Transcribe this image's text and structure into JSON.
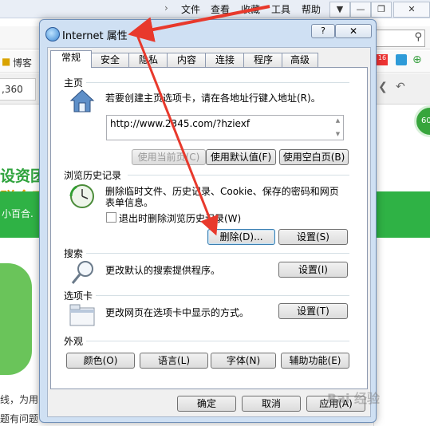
{
  "browser": {
    "menu": [
      "文件",
      "查看",
      "收藏",
      "工具",
      "帮助"
    ],
    "fav_fragment": "博客",
    "tab_fragment": ",360",
    "page_texts": [
      "设资团",
      "赚金币",
      "小百合.",
      "线，为用",
      "题有问题"
    ],
    "side_badge": "60"
  },
  "dialog": {
    "title": "Internet 属性",
    "help_label": "?",
    "close_label": "✕",
    "tabs": [
      "常规",
      "安全",
      "隐私",
      "内容",
      "连接",
      "程序",
      "高级"
    ],
    "active_tab": "常规",
    "homepage": {
      "header": "主页",
      "desc": "若要创建主页选项卡，请在各地址行键入地址(R)。",
      "url": "http://www.2345.com/?hziexf",
      "buttons": {
        "use_current": "使用当前页(C)",
        "use_default": "使用默认值(F)",
        "use_blank": "使用空白页(B)"
      }
    },
    "history": {
      "header": "浏览历史记录",
      "desc_line1": "删除临时文件、历史记录、Cookie、保存的密码和网页",
      "desc_line2": "表单信息。",
      "checkbox_label": "退出时删除浏览历史记录(W)",
      "checked": false,
      "delete_label": "删除(D)...",
      "settings_label": "设置(S)"
    },
    "search": {
      "header": "搜索",
      "desc": "更改默认的搜索提供程序。",
      "settings_label": "设置(I)"
    },
    "tabs_section": {
      "header": "选项卡",
      "desc": "更改网页在选项卡中显示的方式。",
      "settings_label": "设置(T)"
    },
    "appearance": {
      "header": "外观",
      "colors_label": "颜色(O)",
      "languages_label": "语言(L)",
      "fonts_label": "字体(N)",
      "accessibility_label": "辅助功能(E)"
    },
    "footer": {
      "ok_label": "确定",
      "cancel_label": "取消",
      "apply_label": "应用(A)"
    }
  },
  "watermark": "Bai 经验"
}
